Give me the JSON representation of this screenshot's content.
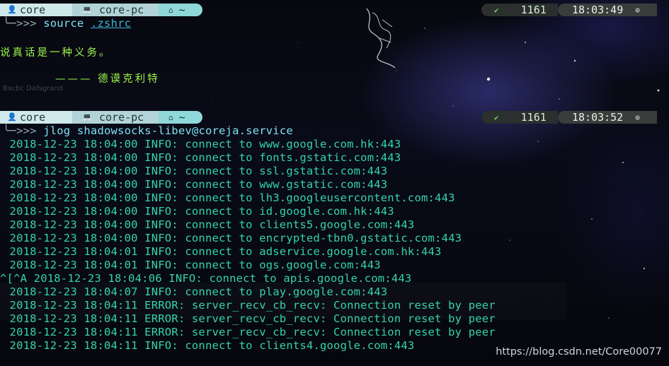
{
  "prompt1": {
    "user": "core",
    "host": "core-pc",
    "dir": "~",
    "status": "1161",
    "time": "18:03:49",
    "command_prefix": "╰─>>> ",
    "command": "source ",
    "command_arg": ".zshrc"
  },
  "quote": {
    "text": "说真话是一种义务。",
    "author": "——— 德谟克利特"
  },
  "ghost_text": "Bxcbc Dafsgrand",
  "prompt2": {
    "user": "core",
    "host": "core-pc",
    "dir": "~",
    "status": "1161",
    "time": "18:03:52",
    "command_prefix": "╰─>>> ",
    "command": "jlog shadowsocks-libev@coreja.service"
  },
  "log_lines": [
    " 2018-12-23 18:04:00 INFO: connect to www.google.com.hk:443",
    " 2018-12-23 18:04:00 INFO: connect to fonts.gstatic.com:443",
    " 2018-12-23 18:04:00 INFO: connect to ssl.gstatic.com:443",
    " 2018-12-23 18:04:00 INFO: connect to www.gstatic.com:443",
    " 2018-12-23 18:04:00 INFO: connect to lh3.googleusercontent.com:443",
    " 2018-12-23 18:04:00 INFO: connect to id.google.com.hk:443",
    " 2018-12-23 18:04:00 INFO: connect to clients5.google.com:443",
    " 2018-12-23 18:04:00 INFO: connect to encrypted-tbn0.gstatic.com:443",
    " 2018-12-23 18:04:01 INFO: connect to adservice.google.com.hk:443",
    " 2018-12-23 18:04:01 INFO: connect to ogs.google.com:443",
    "^[^A 2018-12-23 18:04:06 INFO: connect to apis.google.com:443",
    " 2018-12-23 18:04:07 INFO: connect to play.google.com:443",
    " 2018-12-23 18:04:11 ERROR: server_recv_cb_recv: Connection reset by peer",
    " 2018-12-23 18:04:11 ERROR: server_recv_cb_recv: Connection reset by peer",
    " 2018-12-23 18:04:11 ERROR: server_recv_cb_recv: Connection reset by peer",
    " 2018-12-23 18:04:11 INFO: connect to clients4.google.com:443"
  ],
  "watermark": "https://blog.csdn.net/Core00077",
  "icons": {
    "user": "user-icon",
    "host": "laptop-icon",
    "dir": "home-icon",
    "status": "check-icon",
    "time": "clock-icon"
  }
}
